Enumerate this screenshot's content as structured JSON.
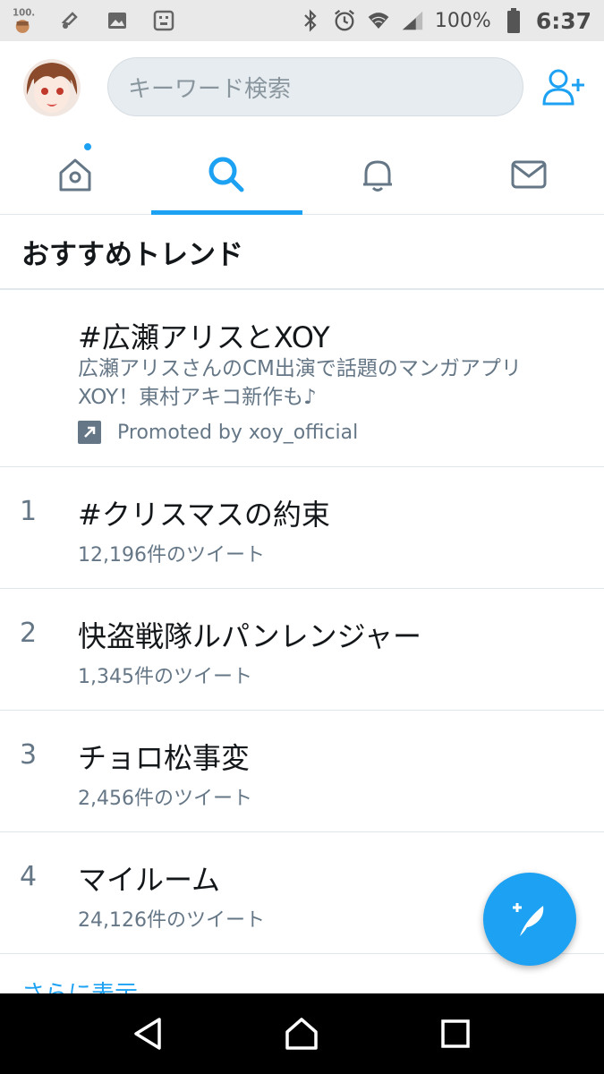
{
  "statusbar": {
    "battery_pct": "100%",
    "time": "6:37",
    "badge_text": "100.",
    "icons": [
      "notification-100-icon",
      "music-icon",
      "image-icon",
      "android-icon",
      "bluetooth-icon",
      "alarm-icon",
      "wifi-icon",
      "signal-icon",
      "battery-icon"
    ]
  },
  "header": {
    "search_placeholder": "キーワード検索"
  },
  "tabs": [
    {
      "name": "home",
      "icon": "home-icon",
      "active": false,
      "has_dot": true
    },
    {
      "name": "search",
      "icon": "search-icon",
      "active": true,
      "has_dot": false
    },
    {
      "name": "notifications",
      "icon": "bell-icon",
      "active": false,
      "has_dot": false
    },
    {
      "name": "messages",
      "icon": "mail-icon",
      "active": false,
      "has_dot": false
    }
  ],
  "section": {
    "title": "おすすめトレンド"
  },
  "promoted": {
    "title": "#広瀬アリスとXOY",
    "description": "広瀬アリスさんのCM出演で話題のマンガアプリXOY！東村アキコ新作も♪",
    "promoted_by": "Promoted by xoy_official"
  },
  "trends": [
    {
      "rank": "1",
      "title": "#クリスマスの約束",
      "count": "12,196件のツイート"
    },
    {
      "rank": "2",
      "title": "快盗戦隊ルパンレンジャー",
      "count": "1,345件のツイート"
    },
    {
      "rank": "3",
      "title": "チョロ松事変",
      "count": "2,456件のツイート"
    },
    {
      "rank": "4",
      "title": "マイルーム",
      "count": "24,126件のツイート"
    }
  ],
  "more_label": "さらに表示",
  "colors": {
    "accent": "#1da1f2",
    "muted_text": "#657786",
    "divider": "#e1e8ed"
  }
}
